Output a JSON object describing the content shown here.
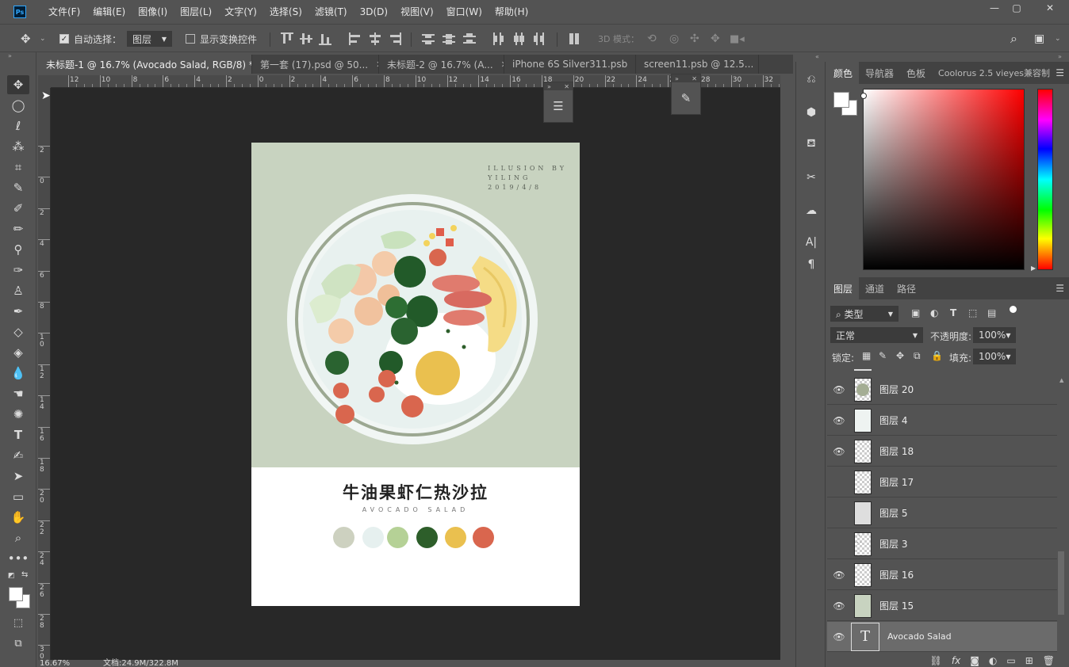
{
  "app": {
    "logo": "Ps"
  },
  "menu": [
    "文件(F)",
    "编辑(E)",
    "图像(I)",
    "图层(L)",
    "文字(Y)",
    "选择(S)",
    "滤镜(T)",
    "3D(D)",
    "视图(V)",
    "窗口(W)",
    "帮助(H)"
  ],
  "options": {
    "auto_select_label": "自动选择：",
    "auto_select_value": "图层",
    "show_transform_label": "显示变换控件",
    "mode_3d_label": "3D 模式："
  },
  "tabs": [
    {
      "label": "未标题-1 @ 16.7% (Avocado Salad, RGB/8) *",
      "active": true
    },
    {
      "label": "第一套 (17).psd @ 50...",
      "active": false
    },
    {
      "label": "未标题-2 @ 16.7% (A...",
      "active": false
    },
    {
      "label": "iPhone 6S Silver311.psb",
      "active": false
    },
    {
      "label": "screen11.psb @ 12.5...",
      "active": false
    }
  ],
  "ruler_h": [
    "12",
    "10",
    "8",
    "6",
    "4",
    "2",
    "0",
    "2",
    "4",
    "6",
    "8",
    "10",
    "12",
    "14",
    "16",
    "18",
    "20",
    "22",
    "24",
    "26",
    "28",
    "30",
    "32"
  ],
  "ruler_v": [
    "2",
    "0",
    "2",
    "4",
    "6",
    "8",
    "10",
    "12",
    "14",
    "16",
    "18",
    "20",
    "22",
    "24",
    "26",
    "28",
    "30"
  ],
  "poster": {
    "illusion_line1": "ILLUSION BY",
    "illusion_line2": "YILING",
    "date": "2019/4/8",
    "title": "牛油果虾仁热沙拉",
    "subtitle": "AVOCADO SALAD",
    "swatches": [
      "#cdd1c0",
      "#e6f0ef",
      "#b5d196",
      "#2d5e2a",
      "#eac04f",
      "#d9664e"
    ]
  },
  "status": {
    "zoom": "16.67%",
    "doc_size": "文档:24.9M/322.8M"
  },
  "color_panel": {
    "tabs": [
      "颜色",
      "导航器",
      "色板",
      "Coolorus 2.5 vieyes兼容制"
    ],
    "hue_color": "#ff0000",
    "foreground": "#ffffff",
    "background": "#ffffff"
  },
  "layers_panel": {
    "tabs": [
      "图层",
      "通道",
      "路径"
    ],
    "filter_label": "类型",
    "blend_mode": "正常",
    "opacity_label": "不透明度:",
    "opacity_value": "100%",
    "lock_label": "锁定:",
    "fill_label": "填充:",
    "fill_value": "100%",
    "layers": [
      {
        "name": "图层 20",
        "visible": true,
        "thumb": "circle",
        "selected": false
      },
      {
        "name": "图层 4",
        "visible": true,
        "thumb": "transparent",
        "selected": false
      },
      {
        "name": "图层 18",
        "visible": true,
        "thumb": "transparent",
        "selected": false
      },
      {
        "name": "图层 17",
        "visible": false,
        "thumb": "transparent",
        "selected": false
      },
      {
        "name": "图层 5",
        "visible": false,
        "thumb": "light",
        "selected": false
      },
      {
        "name": "图层 3",
        "visible": false,
        "thumb": "dots",
        "selected": false
      },
      {
        "name": "图层 16",
        "visible": true,
        "thumb": "transparent",
        "selected": false
      },
      {
        "name": "图层 15",
        "visible": true,
        "thumb": "green",
        "selected": false
      },
      {
        "name": "Avocado Salad",
        "visible": true,
        "thumb": "text",
        "selected": true
      }
    ]
  }
}
